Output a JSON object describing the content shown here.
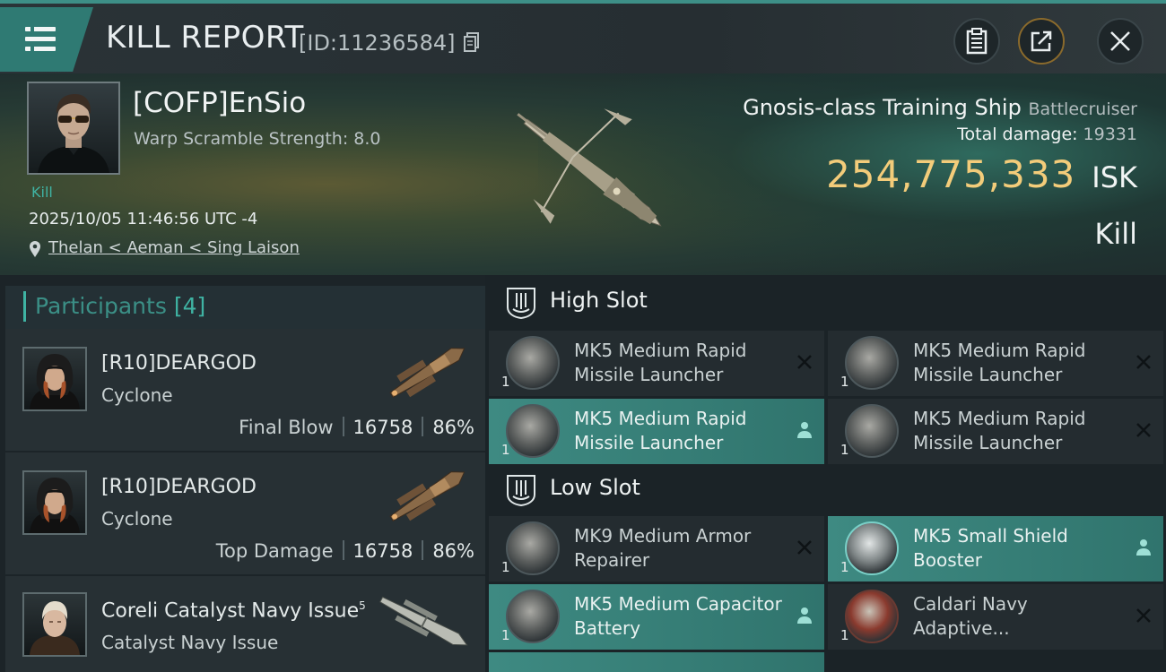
{
  "header": {
    "title": "KILL REPORT",
    "report_id": "[ID:11236584]"
  },
  "victim": {
    "pilot_name": "[COFP]EnSio",
    "warp_scramble": "Warp Scramble Strength: 8.0",
    "kill_tag": "Kill",
    "timestamp": "2025/10/05 11:46:56 UTC -4",
    "location": "Thelan < Aeman < Sing Laison",
    "ship_name": "Gnosis-class Training Ship",
    "ship_class": "Battlecruiser",
    "total_damage_label": "Total damage:",
    "total_damage": "19331",
    "isk_value": "254,775,333",
    "isk_unit": "ISK",
    "result": "Kill"
  },
  "participants": {
    "label": "Participants",
    "count": "[4]",
    "rows": [
      {
        "name": "[R10]DEARGOD",
        "ship": "Cyclone",
        "role": "Final Blow",
        "damage": "16758",
        "percent": "86%"
      },
      {
        "name": "[R10]DEARGOD",
        "ship": "Cyclone",
        "role": "Top Damage",
        "damage": "16758",
        "percent": "86%"
      },
      {
        "name": "Coreli Catalyst Navy Issue",
        "name_sup": "5",
        "ship": "Catalyst Navy Issue"
      }
    ]
  },
  "slots": {
    "high": {
      "label": "High Slot",
      "modules": [
        {
          "name": "MK5 Medium Rapid Missile Launcher",
          "qty": "1",
          "status": "destroyed"
        },
        {
          "name": "MK5 Medium Rapid Missile Launcher",
          "qty": "1",
          "status": "destroyed"
        },
        {
          "name": "MK5 Medium Rapid Missile Launcher",
          "qty": "1",
          "status": "dropped"
        },
        {
          "name": "MK5 Medium Rapid Missile Launcher",
          "qty": "1",
          "status": "destroyed"
        }
      ]
    },
    "low": {
      "label": "Low Slot",
      "modules": [
        {
          "name": "MK9 Medium Armor Repairer",
          "qty": "1",
          "status": "destroyed"
        },
        {
          "name": "MK5 Small Shield Booster",
          "qty": "1",
          "status": "dropped"
        },
        {
          "name": "MK5 Medium Capacitor Battery",
          "qty": "1",
          "status": "dropped"
        },
        {
          "name": "Caldari Navy Adaptive...",
          "qty": "1",
          "status": "destroyed"
        }
      ]
    }
  },
  "colors": {
    "accent": "#3fb3a3",
    "isk": "#f3cc7a",
    "highlight": "#3e8a82"
  }
}
